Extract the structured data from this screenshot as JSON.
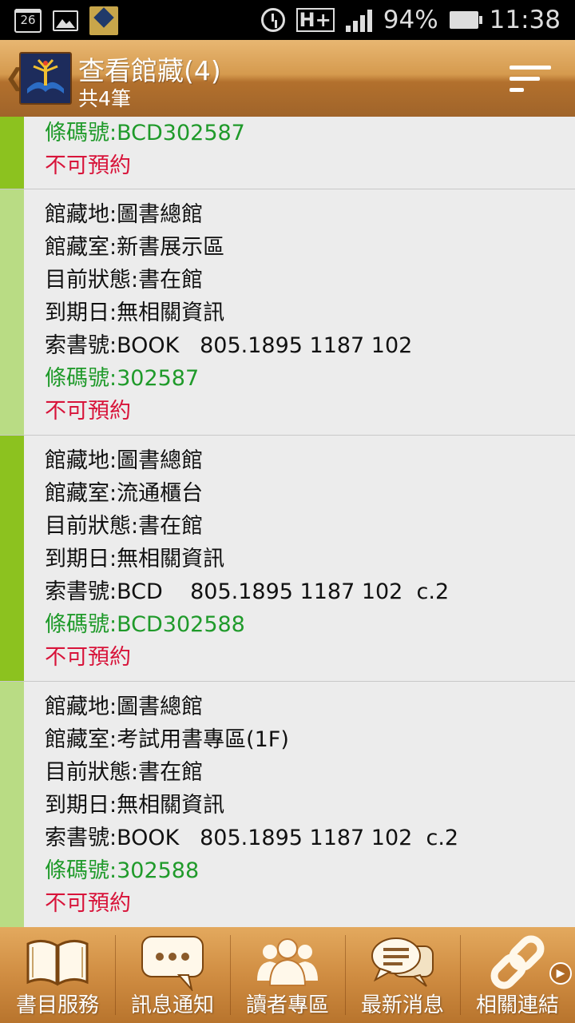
{
  "status_bar": {
    "calendar_day": "26",
    "battery": "94%",
    "time": "11:38",
    "network": "H+"
  },
  "header": {
    "title": "查看館藏(4)",
    "subtitle": "共4筆",
    "back_icon": "chevron-left-icon",
    "menu_icon": "sort-menu-icon"
  },
  "colors": {
    "accent_bar_dark": "#8cc21f",
    "accent_bar_light": "#b9dc84",
    "barcode_green": "#1f9a2a",
    "reserve_red": "#d8143a",
    "header_brown": "#c3843c"
  },
  "records": [
    {
      "lines": [],
      "barcode": "條碼號:BCD302587",
      "reserve": "不可預約"
    },
    {
      "lines": [
        "館藏地:圖書總館",
        "館藏室:新書展示區",
        "目前狀態:書在館",
        "到期日:無相關資訊",
        "索書號:BOOK   805.1895 1187 102"
      ],
      "barcode": "條碼號:302587",
      "reserve": "不可預約"
    },
    {
      "lines": [
        "館藏地:圖書總館",
        "館藏室:流通櫃台",
        "目前狀態:書在館",
        "到期日:無相關資訊",
        "索書號:BCD    805.1895 1187 102  c.2"
      ],
      "barcode": "條碼號:BCD302588",
      "reserve": "不可預約"
    },
    {
      "lines": [
        "館藏地:圖書總館",
        "館藏室:考試用書專區(1F)",
        "目前狀態:書在館",
        "到期日:無相關資訊",
        "索書號:BOOK   805.1895 1187 102  c.2"
      ],
      "barcode": "條碼號:302588",
      "reserve": "不可預約"
    }
  ],
  "bottom_nav": [
    {
      "label": "書目服務",
      "icon": "book-icon"
    },
    {
      "label": "訊息通知",
      "icon": "chat-bubble-icon"
    },
    {
      "label": "讀者專區",
      "icon": "users-icon"
    },
    {
      "label": "最新消息",
      "icon": "news-bubble-icon"
    },
    {
      "label": "相關連結",
      "icon": "link-icon"
    }
  ]
}
